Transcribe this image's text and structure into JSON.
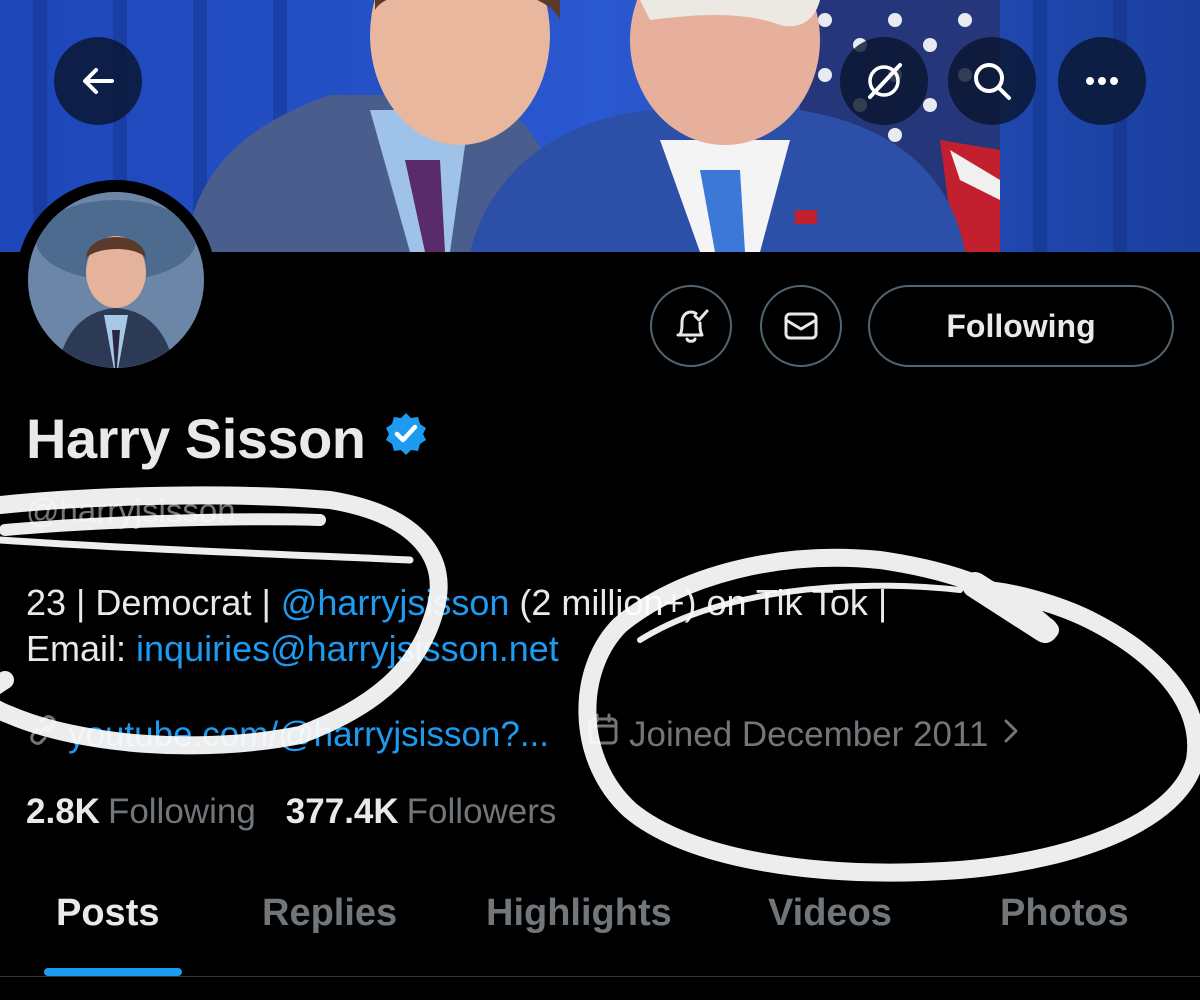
{
  "header": {
    "back_icon": "arrow-left-icon",
    "grok_icon": "grok-icon",
    "search_icon": "search-icon",
    "more_icon": "more-horizontal-icon"
  },
  "profile": {
    "display_name": "Harry Sisson",
    "verified": true,
    "handle": "@harryjsisson",
    "bio_line1": {
      "prefix": "23 | Democrat | ",
      "mention": "@harryjsisson",
      "suffix": " (2 million+) on Tik Tok |"
    },
    "bio_line2": {
      "prefix": "Email: ",
      "email": "inquiries@harryjsisson.net"
    },
    "website": "youtube.com/@harryjsisson?...",
    "joined": "Joined December 2011",
    "following_count": "2.8K",
    "following_label": "Following",
    "followers_count": "377.4K",
    "followers_label": "Followers"
  },
  "actions": {
    "notify_icon": "bell-check-icon",
    "message_icon": "envelope-icon",
    "follow_label": "Following"
  },
  "tabs": [
    {
      "label": "Posts",
      "active": true
    },
    {
      "label": "Replies",
      "active": false
    },
    {
      "label": "Highlights",
      "active": false
    },
    {
      "label": "Videos",
      "active": false
    },
    {
      "label": "Photos",
      "active": false
    }
  ],
  "colors": {
    "background": "#000000",
    "text": "#e7e9ea",
    "muted": "#71767b",
    "accent": "#1d9bf0",
    "border": "#536471"
  }
}
